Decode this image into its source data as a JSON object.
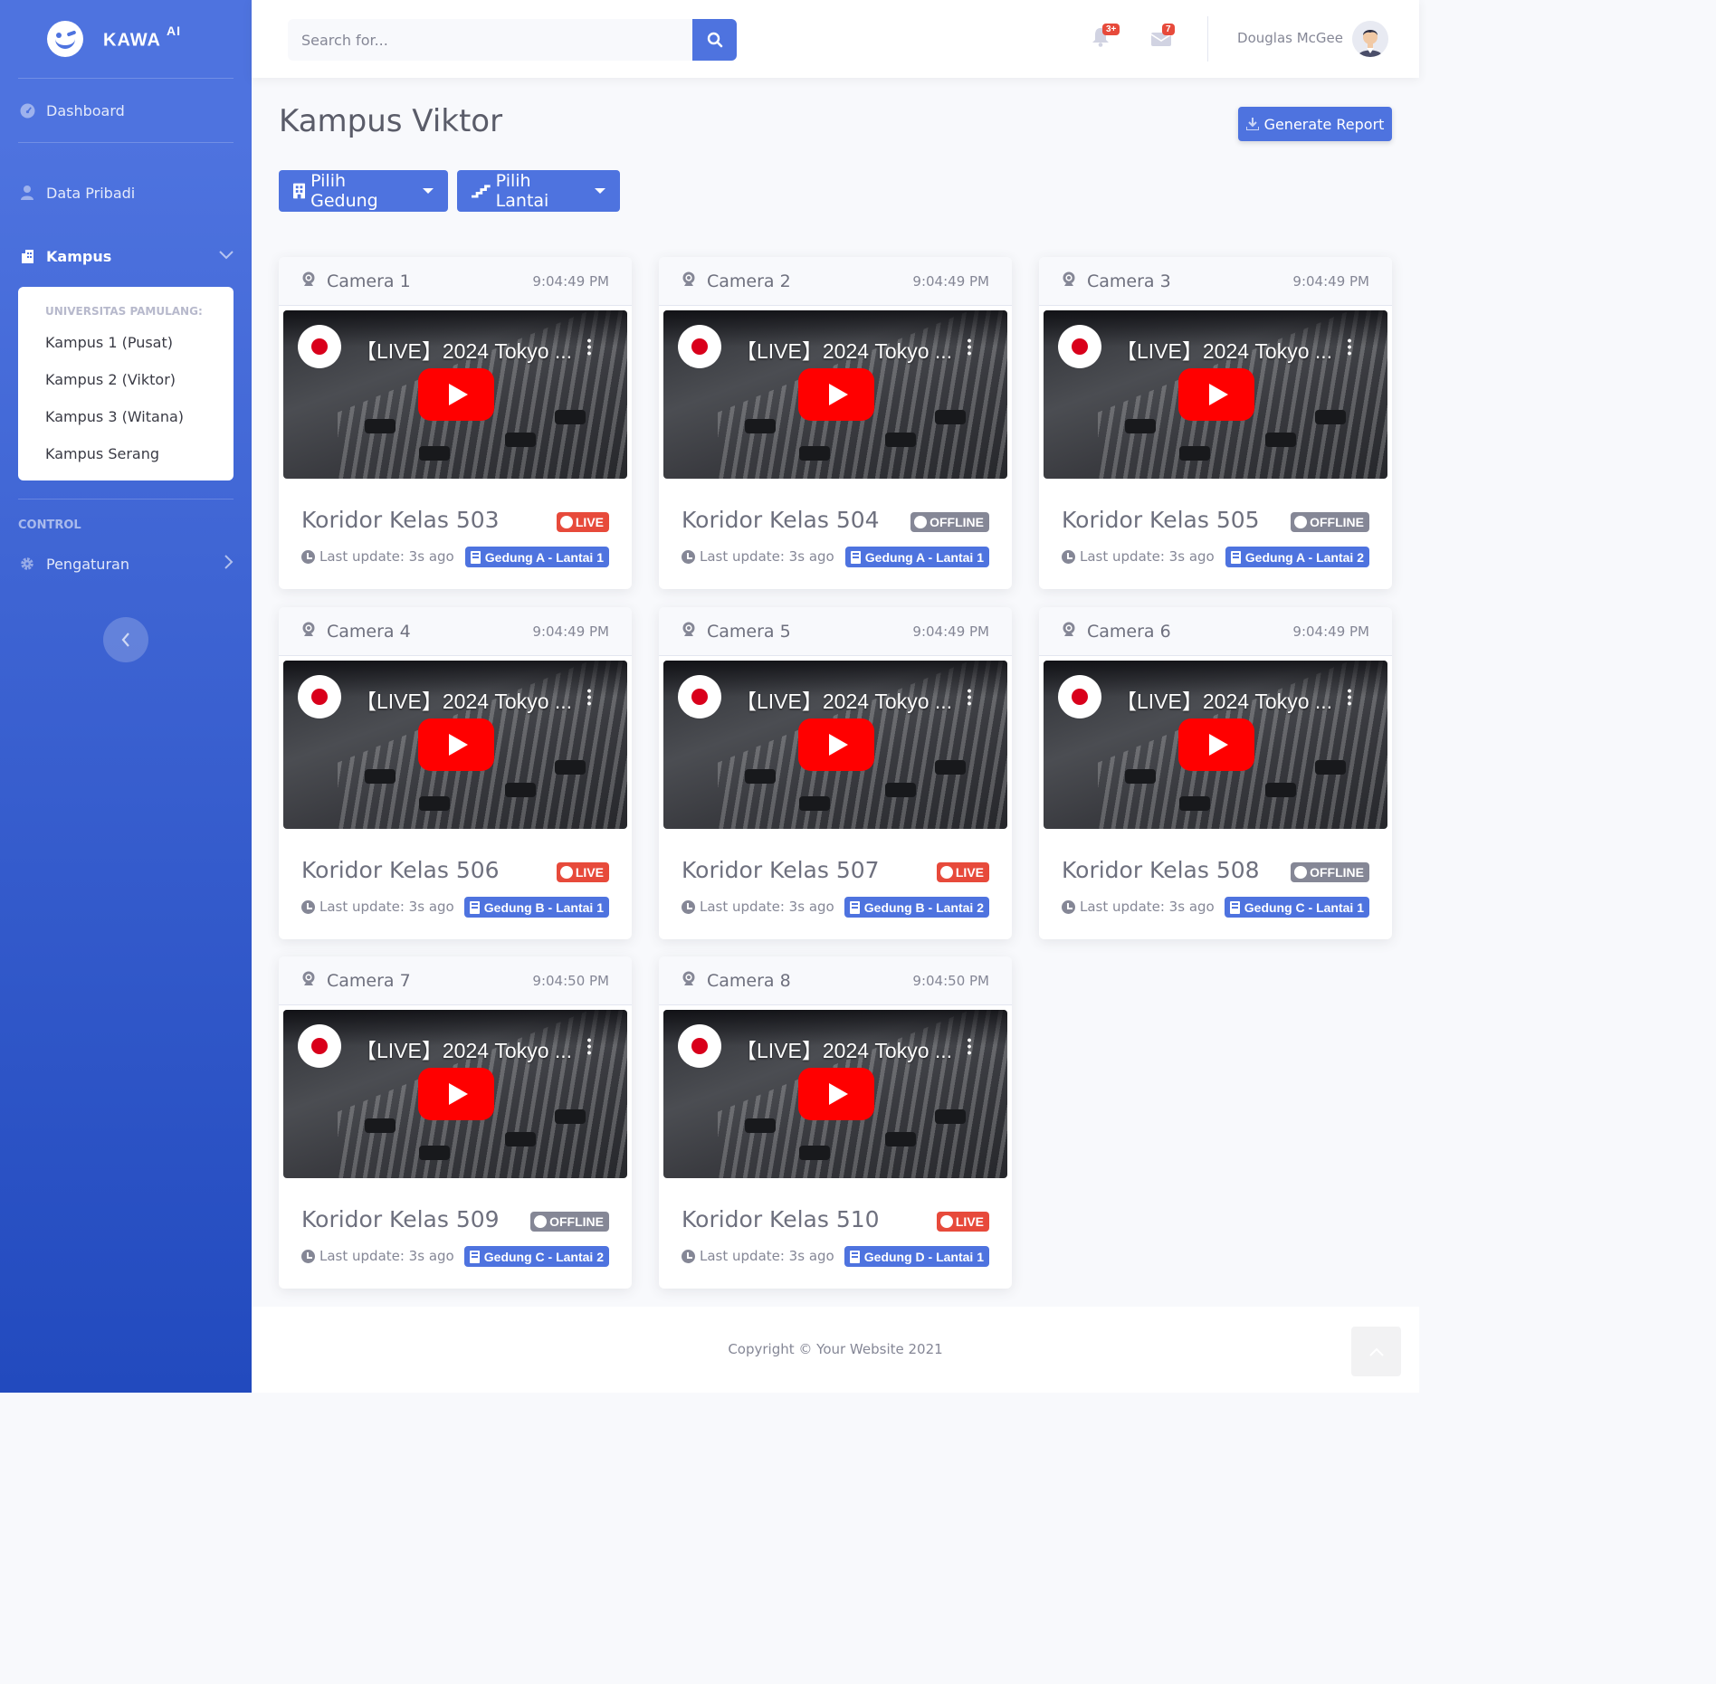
{
  "brand": {
    "name": "KAWA",
    "sup": "AI"
  },
  "sidebar": {
    "dashboard": "Dashboard",
    "data_pribadi": "Data Pribadi",
    "kampus": "Kampus",
    "kampus_header": "UNIVERSITAS PAMULANG:",
    "kampus_items": [
      "Kampus 1 (Pusat)",
      "Kampus 2 (Viktor)",
      "Kampus 3 (Witana)",
      "Kampus Serang"
    ],
    "control_heading": "CONTROL",
    "pengaturan": "Pengaturan"
  },
  "topbar": {
    "search_placeholder": "Search for...",
    "alerts_count": "3+",
    "messages_count": "7",
    "user_name": "Douglas McGee"
  },
  "page": {
    "title": "Kampus Viktor",
    "generate_report": "Generate Report",
    "pilih_gedung": "Pilih Gedung",
    "pilih_lantai": "Pilih Lantai"
  },
  "video_title": "【LIVE】2024 Tokyo ...",
  "cameras": [
    {
      "name": "Camera 1",
      "time": "9:04:49 PM",
      "room": "Koridor Kelas 503",
      "status": "LIVE",
      "update": "Last update: 3s ago",
      "location": "Gedung A - Lantai 1"
    },
    {
      "name": "Camera 2",
      "time": "9:04:49 PM",
      "room": "Koridor Kelas 504",
      "status": "OFFLINE",
      "update": "Last update: 3s ago",
      "location": "Gedung A - Lantai 1"
    },
    {
      "name": "Camera 3",
      "time": "9:04:49 PM",
      "room": "Koridor Kelas 505",
      "status": "OFFLINE",
      "update": "Last update: 3s ago",
      "location": "Gedung A - Lantai 2"
    },
    {
      "name": "Camera 4",
      "time": "9:04:49 PM",
      "room": "Koridor Kelas 506",
      "status": "LIVE",
      "update": "Last update: 3s ago",
      "location": "Gedung B - Lantai 1"
    },
    {
      "name": "Camera 5",
      "time": "9:04:49 PM",
      "room": "Koridor Kelas 507",
      "status": "LIVE",
      "update": "Last update: 3s ago",
      "location": "Gedung B - Lantai 2"
    },
    {
      "name": "Camera 6",
      "time": "9:04:49 PM",
      "room": "Koridor Kelas 508",
      "status": "OFFLINE",
      "update": "Last update: 3s ago",
      "location": "Gedung C - Lantai 1"
    },
    {
      "name": "Camera 7",
      "time": "9:04:50 PM",
      "room": "Koridor Kelas 509",
      "status": "OFFLINE",
      "update": "Last update: 3s ago",
      "location": "Gedung C - Lantai 2"
    },
    {
      "name": "Camera 8",
      "time": "9:04:50 PM",
      "room": "Koridor Kelas 510",
      "status": "LIVE",
      "update": "Last update: 3s ago",
      "location": "Gedung D - Lantai 1"
    }
  ],
  "footer": {
    "copyright": "Copyright © Your Website 2021"
  },
  "colors": {
    "primary": "#4e73df",
    "live": "#e74a3b",
    "offline": "#858796"
  }
}
